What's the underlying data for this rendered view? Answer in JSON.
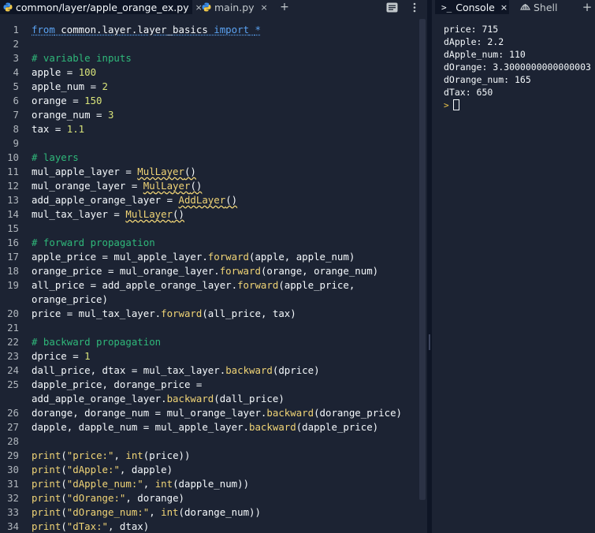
{
  "editor": {
    "tabs": [
      {
        "label": "common/layer/apple_orange_ex.py",
        "close": "×",
        "active": true
      },
      {
        "label": "main.py",
        "close": "×",
        "active": false
      }
    ],
    "add_tab": "+",
    "toolbar_icons": [
      "list-icon",
      "more-vertical-icon"
    ],
    "lines": [
      {
        "n": "1",
        "html": "<span class=\"kw ul\">from</span><span class=\"ul\"> common.layer.layer_basics </span><span class=\"kw ul\">import</span><span class=\"ul\"> </span><span class=\"kw ul\">*</span>"
      },
      {
        "n": "2",
        "html": ""
      },
      {
        "n": "3",
        "html": "<span class=\"cm\"># variable inputs</span>"
      },
      {
        "n": "4",
        "html": "apple = <span class=\"nm\">100</span>"
      },
      {
        "n": "5",
        "html": "apple_num = <span class=\"nm\">2</span>"
      },
      {
        "n": "6",
        "html": "orange = <span class=\"nm\">150</span>"
      },
      {
        "n": "7",
        "html": "orange_num = <span class=\"nm\">3</span>"
      },
      {
        "n": "8",
        "html": "tax = <span class=\"nm\">1.1</span>"
      },
      {
        "n": "9",
        "html": ""
      },
      {
        "n": "10",
        "html": "<span class=\"cm\"># layers</span>"
      },
      {
        "n": "11",
        "html": "mul_apple_layer = <span class=\"fn wavy\">MulLayer</span><span class=\"wavy\">()</span>"
      },
      {
        "n": "12",
        "html": "mul_orange_layer = <span class=\"fn wavy\">MulLayer</span><span class=\"wavy\">()</span>"
      },
      {
        "n": "13",
        "html": "add_apple_orange_layer = <span class=\"fn wavy\">AddLayer</span><span class=\"wavy\">()</span>"
      },
      {
        "n": "14",
        "html": "mul_tax_layer = <span class=\"fn wavy\">MulLayer</span><span class=\"wavy\">()</span>"
      },
      {
        "n": "15",
        "html": ""
      },
      {
        "n": "16",
        "html": "<span class=\"cm\"># forward propagation</span>"
      },
      {
        "n": "17",
        "html": "apple_price = mul_apple_layer.<span class=\"fn\">forward</span>(apple, apple_num)"
      },
      {
        "n": "18",
        "html": "orange_price = mul_orange_layer.<span class=\"fn\">forward</span>(orange, orange_num)"
      },
      {
        "n": "19",
        "html": "all_price = add_apple_orange_layer.<span class=\"fn\">forward</span>(apple_price,"
      },
      {
        "n": "",
        "html": "orange_price)"
      },
      {
        "n": "20",
        "html": "price = mul_tax_layer.<span class=\"fn\">forward</span>(all_price, tax)"
      },
      {
        "n": "21",
        "html": ""
      },
      {
        "n": "22",
        "html": "<span class=\"cm\"># backward propagation</span>"
      },
      {
        "n": "23",
        "html": "dprice = <span class=\"nm\">1</span>"
      },
      {
        "n": "24",
        "html": "dall_price, dtax = mul_tax_layer.<span class=\"fn\">backward</span>(dprice)"
      },
      {
        "n": "25",
        "html": "dapple_price, dorange_price ="
      },
      {
        "n": "",
        "html": "add_apple_orange_layer.<span class=\"fn\">backward</span>(dall_price)"
      },
      {
        "n": "26",
        "html": "dorange, dorange_num = mul_orange_layer.<span class=\"fn\">backward</span>(dorange_price)"
      },
      {
        "n": "27",
        "html": "dapple, dapple_num = mul_apple_layer.<span class=\"fn\">backward</span>(dapple_price)"
      },
      {
        "n": "28",
        "html": ""
      },
      {
        "n": "29",
        "html": "<span class=\"bi\">print</span>(<span class=\"st\">\"price:\"</span>, <span class=\"bi\">int</span>(price))"
      },
      {
        "n": "30",
        "html": "<span class=\"bi\">print</span>(<span class=\"st\">\"dApple:\"</span>, dapple)"
      },
      {
        "n": "31",
        "html": "<span class=\"bi\">print</span>(<span class=\"st\">\"dApple_num:\"</span>, <span class=\"bi\">int</span>(dapple_num))"
      },
      {
        "n": "32",
        "html": "<span class=\"bi\">print</span>(<span class=\"st\">\"dOrange:\"</span>, dorange)"
      },
      {
        "n": "33",
        "html": "<span class=\"bi\">print</span>(<span class=\"st\">\"dOrange_num:\"</span>, <span class=\"bi\">int</span>(dorange_num))"
      },
      {
        "n": "34",
        "html": "<span class=\"bi\">print</span>(<span class=\"st\">\"dTax:\"</span>, dtax)"
      }
    ]
  },
  "console": {
    "tabs": [
      {
        "label": "Console",
        "close": "×",
        "active": true,
        "icon": ">_"
      },
      {
        "label": "Shell",
        "active": false
      }
    ],
    "add_tab": "+",
    "output": [
      "price: 715",
      "dApple: 2.2",
      "dApple_num: 110",
      "dOrange: 3.3000000000000003",
      "dOrange_num: 165",
      "dTax: 650"
    ],
    "prompt": ">"
  },
  "colors": {
    "background": "#1c2333",
    "tab_active": "#0e1525",
    "keyword": "#5ba3f3",
    "comment": "#2fb87a",
    "number": "#d8e37a",
    "function": "#f0d476"
  }
}
